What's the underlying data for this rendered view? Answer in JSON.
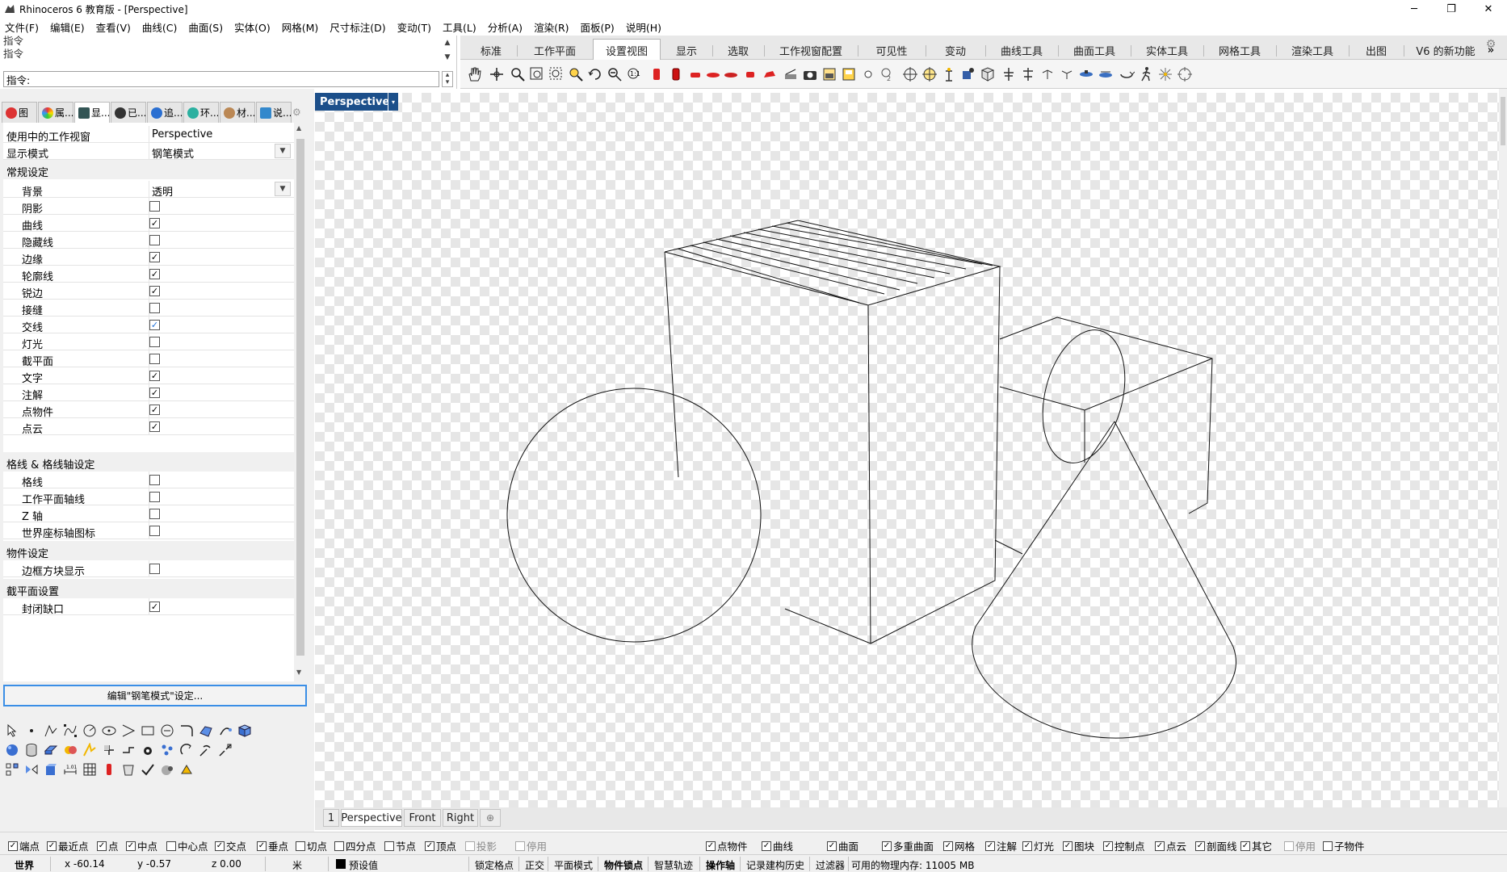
{
  "window": {
    "title": "Rhinoceros 6 教育版 - [Perspective]",
    "minimize": "─",
    "restore": "❐",
    "close": "✕"
  },
  "menu": [
    "文件(F)",
    "编辑(E)",
    "查看(V)",
    "曲线(C)",
    "曲面(S)",
    "实体(O)",
    "网格(M)",
    "尺寸标注(D)",
    "变动(T)",
    "工具(L)",
    "分析(A)",
    "渲染(R)",
    "面板(P)",
    "说明(H)"
  ],
  "command": {
    "history": [
      "指令",
      "指令"
    ],
    "prompt": "指令:"
  },
  "toolbar_tabs": {
    "items": [
      "标准",
      "工作平面",
      "设置视图",
      "显示",
      "选取",
      "工作视窗配置",
      "可见性",
      "变动",
      "曲线工具",
      "曲面工具",
      "实体工具",
      "网格工具",
      "渲染工具",
      "出图",
      "V6 的新功能"
    ],
    "active": "设置视图",
    "more": "»"
  },
  "panel_tabs": [
    "图",
    "属...",
    "显...",
    "已...",
    "追...",
    "环...",
    "材...",
    "说..."
  ],
  "properties": {
    "viewport_label": "使用中的工作视窗",
    "viewport_value": "Perspective",
    "mode_label": "显示模式",
    "mode_value": "钢笔模式",
    "sec_general": "常规设定",
    "background_label": "背景",
    "background_value": "透明",
    "general_items": [
      {
        "label": "阴影",
        "checked": false
      },
      {
        "label": "曲线",
        "checked": true
      },
      {
        "label": "隐藏线",
        "checked": false
      },
      {
        "label": "边缘",
        "checked": true
      },
      {
        "label": "轮廓线",
        "checked": true
      },
      {
        "label": "锐边",
        "checked": true
      },
      {
        "label": "接缝",
        "checked": false
      },
      {
        "label": "交线",
        "checked": true
      },
      {
        "label": "灯光",
        "checked": false
      },
      {
        "label": "截平面",
        "checked": false
      },
      {
        "label": "文字",
        "checked": true
      },
      {
        "label": "注解",
        "checked": true
      },
      {
        "label": "点物件",
        "checked": true
      },
      {
        "label": "点云",
        "checked": true
      }
    ],
    "sec_grid": "格线 & 格线轴设定",
    "grid_items": [
      {
        "label": "格线",
        "checked": false
      },
      {
        "label": "工作平面轴线",
        "checked": false
      },
      {
        "label": "Z 轴",
        "checked": false
      },
      {
        "label": "世界座标轴图标",
        "checked": false
      }
    ],
    "sec_object": "物件设定",
    "object_items": [
      {
        "label": "边框方块显示",
        "checked": false
      }
    ],
    "sec_clip": "截平面设置",
    "clip_items": [
      {
        "label": "封闭缺口",
        "checked": true
      }
    ],
    "edit_button": "编辑\"钢笔模式\"设定..."
  },
  "viewport": {
    "title": "Perspective",
    "dropdown": "▾"
  },
  "viewport_tabs": {
    "number": "1",
    "items": [
      "Perspective",
      "Front",
      "Right"
    ],
    "active": "Perspective",
    "add": "⊕"
  },
  "osnaps": [
    {
      "label": "端点",
      "checked": true
    },
    {
      "label": "最近点",
      "checked": true
    },
    {
      "label": "点",
      "checked": true
    },
    {
      "label": "中点",
      "checked": true
    },
    {
      "label": "中心点",
      "checked": false
    },
    {
      "label": "交点",
      "checked": true
    },
    {
      "label": "垂点",
      "checked": true
    },
    {
      "label": "切点",
      "checked": false
    },
    {
      "label": "四分点",
      "checked": false
    },
    {
      "label": "节点",
      "checked": false
    },
    {
      "label": "顶点",
      "checked": true
    },
    {
      "label": "投影",
      "checked": false
    },
    {
      "label": "停用",
      "checked": false
    }
  ],
  "filters": [
    {
      "label": "点物件",
      "checked": true
    },
    {
      "label": "曲线",
      "checked": true
    },
    {
      "label": "曲面",
      "checked": true
    },
    {
      "label": "多重曲面",
      "checked": true
    },
    {
      "label": "网格",
      "checked": true
    },
    {
      "label": "注解",
      "checked": true
    },
    {
      "label": "灯光",
      "checked": true
    },
    {
      "label": "图块",
      "checked": true
    },
    {
      "label": "控制点",
      "checked": true
    },
    {
      "label": "点云",
      "checked": true
    },
    {
      "label": "剖面线",
      "checked": true
    },
    {
      "label": "其它",
      "checked": true
    },
    {
      "label": "停用",
      "checked": false
    },
    {
      "label": "子物件",
      "checked": false
    }
  ],
  "status": {
    "cplane": "世界",
    "x": "x -60.14",
    "y": "y -0.57",
    "z": "z 0.00",
    "unit": "米",
    "layer": "预设值",
    "grid_snap": "锁定格点",
    "ortho": "正交",
    "planar": "平面模式",
    "osnap": "物件锁点",
    "smarttrack": "智慧轨迹",
    "gumball": "操作轴",
    "history": "记录建构历史",
    "filter": "过滤器",
    "memory": "可用的物理内存: 11005 MB"
  },
  "colors": {
    "viewport_title_bg": "#1c4f8a",
    "focus_border": "#3a8ee6",
    "checkbox_blue": "#1e6fd9"
  }
}
